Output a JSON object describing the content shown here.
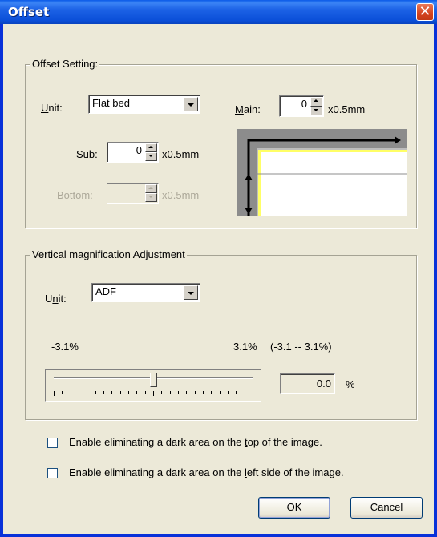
{
  "window": {
    "title": "Offset",
    "close_glyph": "✕"
  },
  "offset": {
    "legend": "Offset Setting:",
    "unit": {
      "label_u": "U",
      "label_rest": "nit:",
      "value": "Flat bed"
    },
    "main": {
      "label_u": "M",
      "label_rest": "ain:",
      "value": "0",
      "unit": "x0.5mm"
    },
    "sub": {
      "label_u": "S",
      "label_rest": "ub:",
      "value": "0",
      "unit": "x0.5mm"
    },
    "bottom": {
      "label_u": "B",
      "label_rest": "ottom:",
      "value": "",
      "unit": "x0.5mm"
    }
  },
  "vmag": {
    "legend": "Vertical magnification Adjustment",
    "unit": {
      "label_pre": "U",
      "label_u": "n",
      "label_rest": "it:",
      "value": "ADF"
    },
    "min_label": "-3.1%",
    "max_label": "3.1%",
    "range_label": "(-3.1 -- 3.1%)",
    "value": "0.0",
    "value_unit": "%",
    "slider_fraction": 0.5
  },
  "options": {
    "top": {
      "pre": "Enable eliminating a dark area on the ",
      "u": "t",
      "post": "op of the image.",
      "checked": false
    },
    "left": {
      "pre": "Enable eliminating a dark area on the ",
      "u": "l",
      "post": "eft side of the image.",
      "checked": false
    }
  },
  "buttons": {
    "ok": "OK",
    "cancel": "Cancel"
  },
  "colors": {
    "titlebar": "#0a5ae8",
    "dialog_bg": "#ece9d8",
    "preview_highlight": "#ffff66"
  }
}
